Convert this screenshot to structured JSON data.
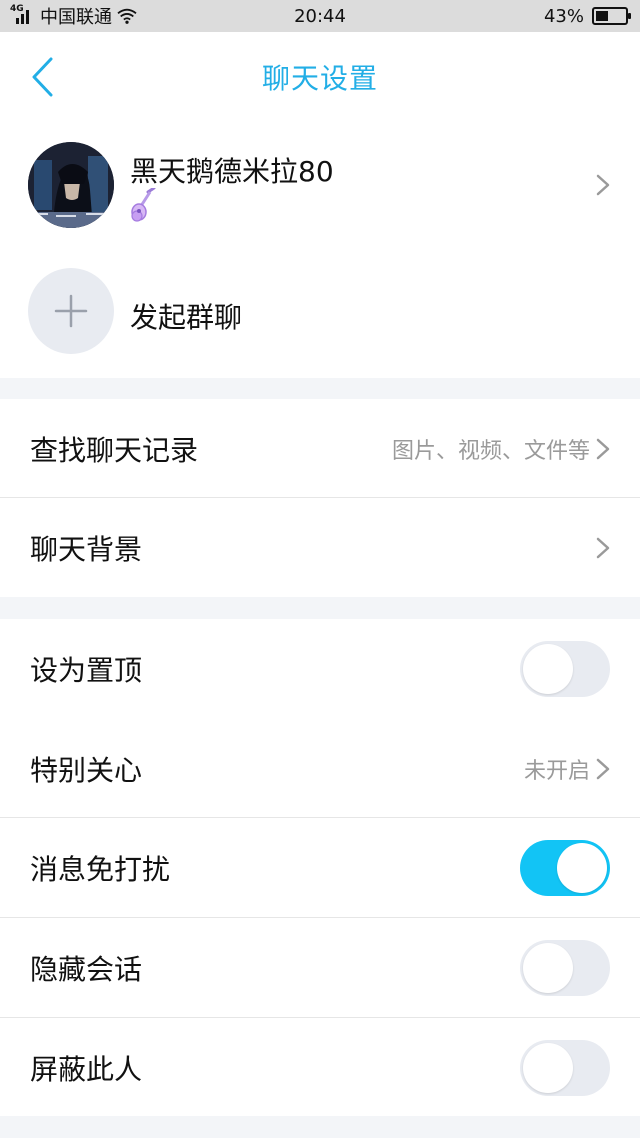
{
  "status_bar": {
    "network": "4G",
    "carrier": "中国联通",
    "time": "20:44",
    "battery": "43%",
    "battery_level": 0.43
  },
  "header": {
    "title": "聊天设置",
    "back_icon": "chevron-left-icon",
    "accent_color": "#22aee6"
  },
  "contact": {
    "name": "黑天鹅德米拉80",
    "badge_icon": "guitar-icon"
  },
  "group_chat": {
    "label": "发起群聊",
    "icon": "plus-icon"
  },
  "history_section": {
    "rows": [
      {
        "label": "查找聊天记录",
        "value": "图片、视频、文件等"
      },
      {
        "label": "聊天背景",
        "value": ""
      }
    ]
  },
  "settings_section": {
    "rows": [
      {
        "label": "设为置顶",
        "type": "toggle",
        "on": false
      },
      {
        "label": "特别关心",
        "type": "link",
        "value": "未开启"
      },
      {
        "label": "消息免打扰",
        "type": "toggle",
        "on": true
      },
      {
        "label": "隐藏会话",
        "type": "toggle",
        "on": false
      },
      {
        "label": "屏蔽此人",
        "type": "toggle",
        "on": false
      }
    ]
  },
  "colors": {
    "toggle_on": "#12c4f5",
    "toggle_off": "#e8ebf1",
    "page_bg": "#f3f5f8"
  }
}
